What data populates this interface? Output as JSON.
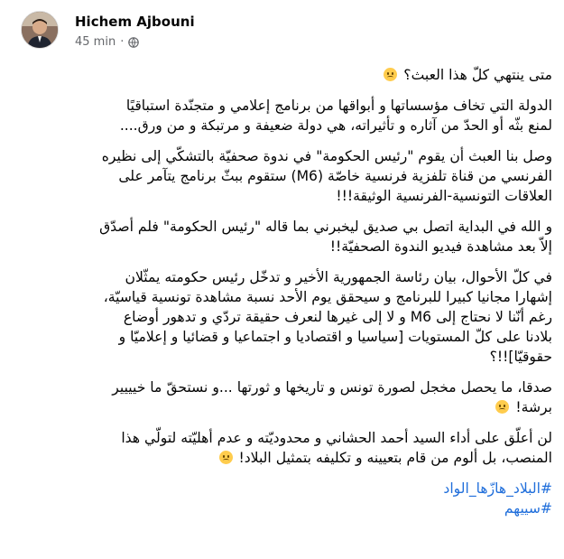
{
  "author": {
    "name": "Hichem Ajbouni",
    "time": "45 min",
    "privacy_icon": "globe-icon"
  },
  "post": {
    "paragraphs": [
      [
        "متى ينتهي كلّ هذا العبث؟"
      ],
      [
        "الدولة التي تخاف مؤسساتها و أبواقها من برنامج إعلامي و متجنّدة استباقيًا",
        "لمنع بثّه أو الحدّ من آثاره و تأثيراته، هي دولة ضعيفة و مرتبكة و من ورق...."
      ],
      [
        "وصل بنا العبث أن يقوم \"رئيس الحكومة\" في ندوة صحفيّة بالتشكّي إلى نظيره",
        "الفرنسي من قناة تلفزية فرنسية خاصّة (M6) ستقوم ببثّ برنامج يتآمر على",
        "العلاقات التونسية-الفرنسية الوثيقة!!!"
      ],
      [
        "و الله في البداية اتصل بي صديق ليخبرني بما قاله \"رئيس الحكومة\" فلم أصدّق",
        "إلاّ بعد مشاهدة فيديو الندوة الصحفيّة!!"
      ],
      [
        "في كلّ الأحوال، بيان رئاسة الجمهورية الأخير و تدخّل رئيس حكومته يمثّلان",
        "إشهارا مجانيا كبيرا للبرنامج و سيحقق يوم الأحد نسبة مشاهدة تونسية قياسيّة،",
        "رغم أنّنا لا نحتاج إلى M6 و لا إلى غيرها لنعرف حقيقة تردّي و تدهور أوضاع",
        "بلادنا على كلّ المستويات [سياسيا و اقتصاديا و اجتماعيا و قضائيا و إعلاميّا و",
        "حقوقيّا]!!؟"
      ],
      [
        "صدقا، ما يحصل مخجل لصورة تونس و تاريخها و ثورتها ...و نستحقّ ما خيييير",
        "برشة!"
      ],
      [
        "لن أعلّق على أداء السيد أحمد الحشاني و محدوديّته و عدم أهليّته لتولّي هذا",
        "المنصب، بل ألوم من قام بتعيينه و تكليفه بتمثيل البلاد!"
      ]
    ],
    "hashtags": [
      "#البلاد_هازّها_الواد",
      "#سييهم"
    ]
  }
}
